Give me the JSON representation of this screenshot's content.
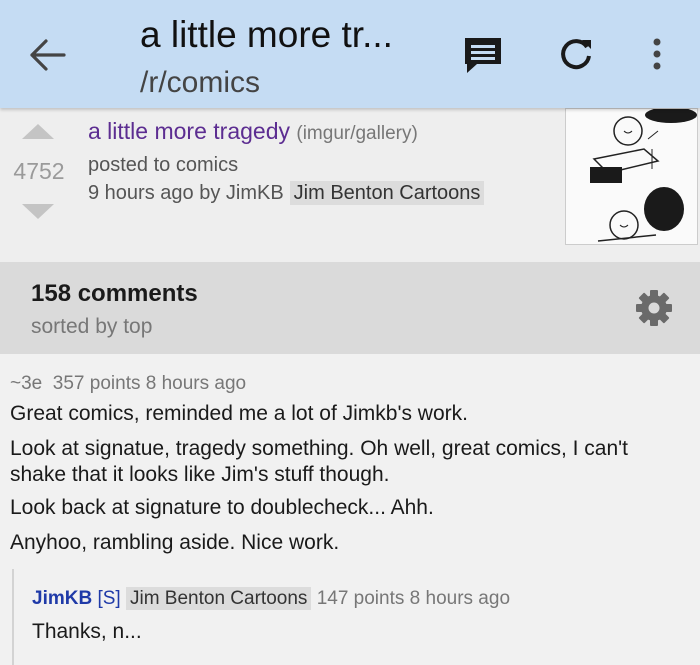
{
  "appbar": {
    "title": "a little more tr...",
    "subtitle": "/r/comics",
    "icons": [
      "back-arrow-icon",
      "comment-icon",
      "refresh-icon",
      "more-vert-icon"
    ]
  },
  "post": {
    "score": "4752",
    "title": "a little more tragedy",
    "domain": "(imgur/gallery)",
    "posted_to": "posted to comics",
    "time_by": "9 hours ago by JimKB",
    "flair": "Jim Benton Cartoons"
  },
  "comments_header": {
    "count": "158 comments",
    "sorted": "sorted by top"
  },
  "comment": {
    "author": "~3e",
    "points": "357 points",
    "time": "8 hours ago",
    "lines": [
      "Great comics, reminded me a lot of Jimkb's work.",
      "Look at signatue, tragedy something. Oh well, great comics, I can't",
      "shake that it looks like Jim's stuff though.",
      "Look back at signature to doublecheck... Ahh.",
      "Anyhoo, rambling aside. Nice work."
    ]
  },
  "reply": {
    "author": "JimKB",
    "submitter_tag": "[S]",
    "flair": "Jim Benton Cartoons",
    "points": "147 points",
    "time": "8 hours ago",
    "body": "Thanks, n..."
  },
  "colors": {
    "appbar": "#c5dcf3",
    "title_visited": "#5c2d91",
    "author_link": "#1f3aa8"
  }
}
